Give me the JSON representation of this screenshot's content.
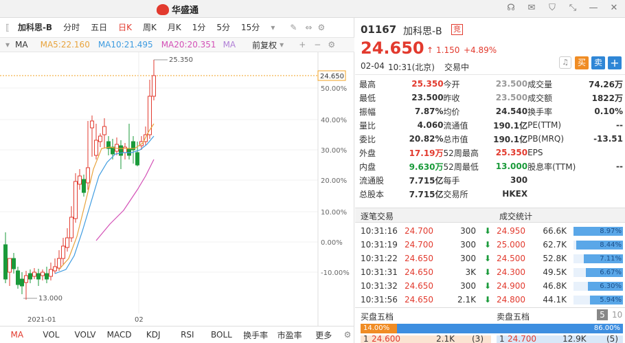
{
  "app": {
    "name": "华盛通"
  },
  "toolbar": {
    "items": [
      "加科思-B",
      "分时",
      "五日",
      "日K",
      "周K",
      "月K",
      "1分",
      "5分",
      "15分"
    ],
    "active": "日K"
  },
  "ma": {
    "label": "MA",
    "ma5": "MA5:22.160",
    "ma10": "MA10:21.495",
    "ma20": "MA20:20.351",
    "ma_more": "MA",
    "adjust": "前复权"
  },
  "chart": {
    "high_label": "25.350",
    "low_label": "13.000",
    "price_tag": "24.650",
    "x_labels": [
      "2021-01",
      "02"
    ],
    "y_labels": [
      "50.00%",
      "40.00%",
      "30.00%",
      "20.00%",
      "10.00%",
      "0.00%",
      "-10.00%"
    ]
  },
  "chart_data": {
    "type": "candlestick",
    "high": 25.35,
    "low": 13.0,
    "last": 24.65,
    "y_percent_ticks": [
      50,
      40,
      30,
      20,
      10,
      0,
      -10
    ]
  },
  "bottom_tabs": [
    "MA",
    "VOL",
    "VOLV",
    "MACD",
    "KDJ",
    "RSI",
    "BOLL",
    "换手率",
    "市盈率",
    "更多"
  ],
  "stock": {
    "code": "01167",
    "name": "加科思-B",
    "badge": "竞",
    "price": "24.650",
    "change": "1.150",
    "pct": "+4.89%",
    "date": "02-04",
    "time": "10:31(北京)",
    "status": "交易中",
    "buy": "买",
    "sell": "卖"
  },
  "stats": [
    [
      "最高",
      "25.350",
      "今开",
      "23.500",
      "成交量",
      "74.26万"
    ],
    [
      "最低",
      "23.500",
      "昨收",
      "23.500",
      "成交额",
      "1822万"
    ],
    [
      "振幅",
      "7.87%",
      "均价",
      "24.540",
      "换手率",
      "0.10%"
    ],
    [
      "量比",
      "4.060",
      "流通值",
      "190.1亿",
      "PE(TTM)",
      "--"
    ],
    [
      "委比",
      "20.82%",
      "总市值",
      "190.1亿",
      "PB(MRQ)",
      "-13.51"
    ],
    [
      "外盘",
      "17.19万",
      "52周最高",
      "25.350",
      "EPS",
      ""
    ],
    [
      "内盘",
      "9.630万",
      "52周最低",
      "13.000",
      "股息率(TTM)",
      "--"
    ],
    [
      "流通股",
      "7.715亿",
      "每手",
      "300",
      "",
      ""
    ],
    [
      "总股本",
      "7.715亿",
      "交易所",
      "HKEX",
      "",
      ""
    ]
  ],
  "ticks_title": "逐笔交易",
  "dist_title": "成交统计",
  "ticks": [
    [
      "10:31:16",
      "24.700",
      "300"
    ],
    [
      "10:31:19",
      "24.700",
      "300"
    ],
    [
      "10:31:22",
      "24.650",
      "300"
    ],
    [
      "10:31:31",
      "24.650",
      "3K"
    ],
    [
      "10:31:32",
      "24.650",
      "300"
    ],
    [
      "10:31:56",
      "24.650",
      "2.1K"
    ]
  ],
  "dist": [
    [
      "24.950",
      "66.6K",
      "8.97%",
      8.97
    ],
    [
      "25.000",
      "62.7K",
      "8.44%",
      8.44
    ],
    [
      "24.500",
      "52.8K",
      "7.11%",
      7.11
    ],
    [
      "24.300",
      "49.5K",
      "6.67%",
      6.67
    ],
    [
      "24.900",
      "46.8K",
      "6.30%",
      6.3
    ],
    [
      "24.800",
      "44.1K",
      "5.94%",
      5.94
    ]
  ],
  "book": {
    "buy_title": "买盘五档",
    "sell_title": "卖盘五档",
    "num5": "5",
    "num10": "10",
    "buy_pct": "14.00%",
    "sell_pct": "86.00%",
    "buy_pct_val": 14,
    "b1": [
      "1",
      "24.600",
      "2.1K",
      "(3)"
    ],
    "s1": [
      "1",
      "24.700",
      "12.9K",
      "(5)"
    ]
  }
}
